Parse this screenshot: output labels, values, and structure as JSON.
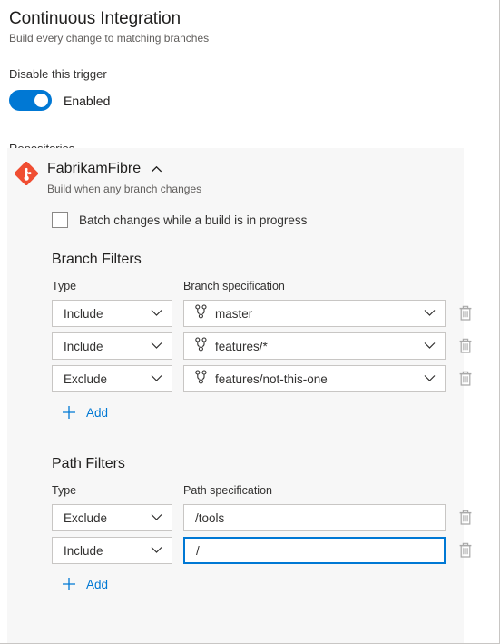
{
  "header": {
    "title": "Continuous Integration",
    "subtitle": "Build every change to matching branches",
    "trigger_label": "Disable this trigger",
    "toggle_state_label": "Enabled",
    "toggle_on": true,
    "repositories_label": "Repositories"
  },
  "repository": {
    "name": "FabrikamFibre",
    "description": "Build when any branch changes",
    "icon": "git-repo-icon",
    "collapse_icon": "chevron-up-icon",
    "batch_checkbox_label": "Batch changes while a build is in progress",
    "batch_checked": false
  },
  "branch_filters": {
    "title": "Branch Filters",
    "type_column_header": "Type",
    "spec_column_header": "Branch specification",
    "rows": [
      {
        "type": "Include",
        "spec": "master",
        "icon": "git-branch-icon",
        "focused": false
      },
      {
        "type": "Include",
        "spec": "features/*",
        "icon": "git-branch-icon",
        "focused": false
      },
      {
        "type": "Exclude",
        "spec": "features/not-this-one",
        "icon": "git-branch-icon",
        "focused": false
      }
    ],
    "add_label": "Add"
  },
  "path_filters": {
    "title": "Path Filters",
    "type_column_header": "Type",
    "spec_column_header": "Path specification",
    "rows": [
      {
        "type": "Exclude",
        "spec": "/tools",
        "icon": "",
        "focused": false
      },
      {
        "type": "Include",
        "spec": "/",
        "icon": "",
        "focused": true
      }
    ],
    "add_label": "Add"
  },
  "icons": {
    "delete": "trash-icon",
    "add": "plus-icon",
    "dropdown": "chevron-down-icon"
  },
  "colors": {
    "accent": "#0078d4",
    "card_bg": "#f7f7f7",
    "border": "#c8c6c4",
    "git_red": "#f04e32",
    "text": "#201f1e",
    "muted_text": "#605e5c"
  }
}
